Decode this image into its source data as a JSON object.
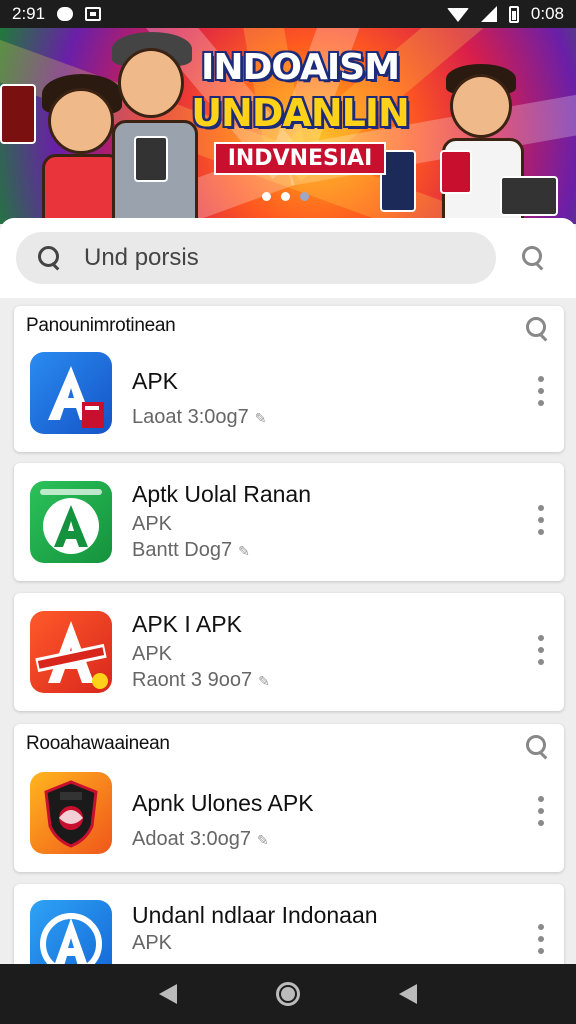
{
  "status_bar": {
    "time": "2:91",
    "battery_time": "0:08"
  },
  "banner": {
    "title_line1": "INDOAISM",
    "title_line2": "UNDANLIN",
    "title_line3": "INDVNESIAI",
    "pager_total": 3,
    "pager_active": 0,
    "colors": {
      "orange": "#ff5a1f",
      "red": "#d91e4a",
      "purple": "#6a1fa8",
      "yellow": "#ffd21a"
    }
  },
  "search": {
    "placeholder": "Und porsis",
    "icon": "search-icon"
  },
  "sections": [
    {
      "title": "Panounimrotinean",
      "icon": "search-icon",
      "apps": [
        {
          "name": "APK",
          "subtitle": "",
          "meta": "Laoat 3:0og7",
          "icon_color": "#1e6fd9"
        },
        {
          "name": "Aptk Uolal Ranan",
          "subtitle": "APK",
          "meta": "Bantt Dog7",
          "icon_color": "#1fae4b"
        },
        {
          "name": "APK I APK",
          "subtitle": "APK",
          "meta": "Raont 3 9oo7",
          "icon_color": "#ee3a22"
        }
      ]
    },
    {
      "title": "Rooahawaainean",
      "icon": "search-icon",
      "apps": [
        {
          "name": "Apnk Ulones APK",
          "subtitle": "",
          "meta": "Adoat 3:0og7",
          "icon_color": "#f07a1a"
        },
        {
          "name": "Undanl ndlaar Indonaan",
          "subtitle": "APK",
          "meta": "",
          "icon_color": "#1e7fe0"
        }
      ]
    }
  ],
  "nav": {
    "back_icon": "back-icon",
    "home_icon": "home-icon",
    "recent_icon": "back-icon"
  }
}
